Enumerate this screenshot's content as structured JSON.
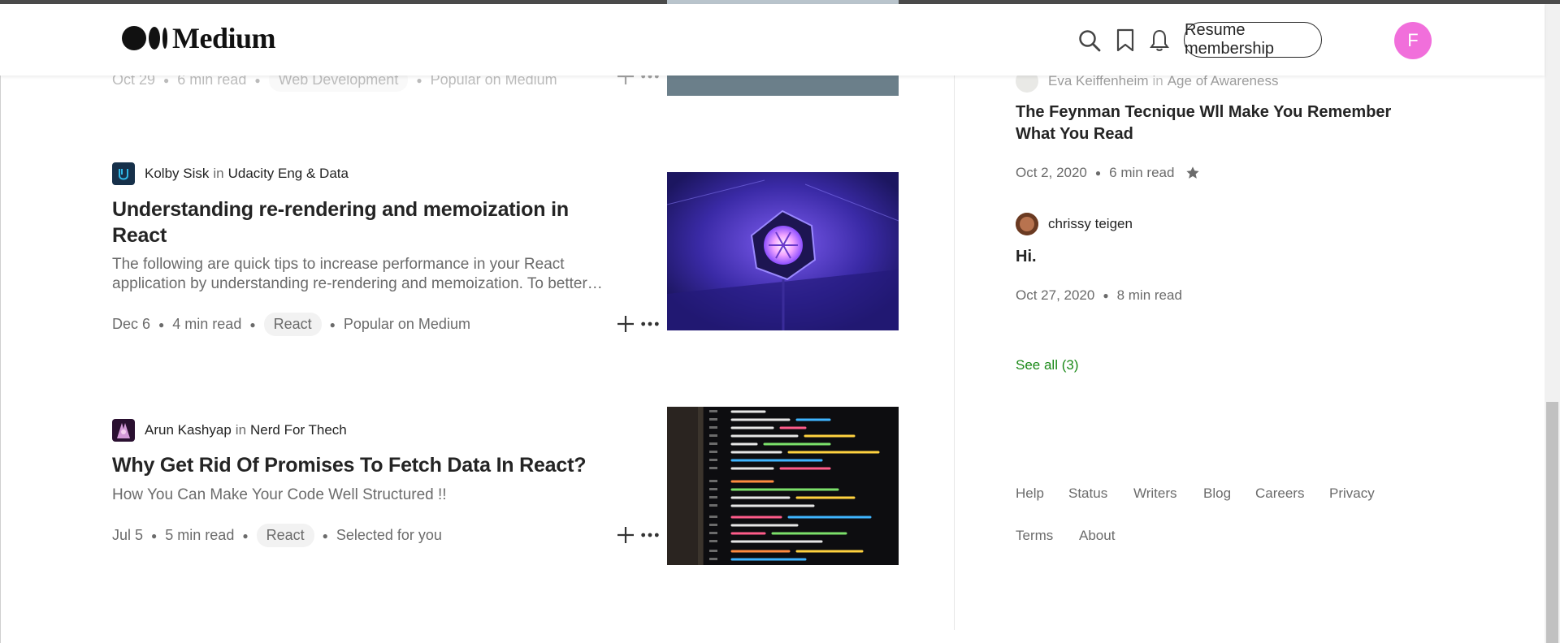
{
  "header": {
    "logo_text": "Medium",
    "icons": [
      "search-icon",
      "bookmark-icon",
      "bell-icon"
    ],
    "resume_label": "Resume membership",
    "avatar_initial": "F",
    "avatar_color": "#f16fdb"
  },
  "articles": [
    {
      "date": "Oct 29",
      "read_time": "6 min read",
      "tag": "Web Development",
      "context": "Popular on Medium"
    },
    {
      "author": "Kolby Sisk",
      "in_label": "in",
      "publication": "Udacity Eng & Data",
      "title": "Understanding re-rendering and memoization in React",
      "subtitle": "The following are quick tips to increase performance in your React application by understanding re-rendering and memoization. To better…",
      "date": "Dec 6",
      "read_time": "4 min read",
      "tag": "React",
      "context": "Popular on Medium"
    },
    {
      "author": "Arun Kashyap",
      "in_label": "in",
      "publication": "Nerd For Thech",
      "title": "Why Get Rid Of Promises To Fetch Data In React?",
      "subtitle": "How You Can Make Your Code Well Structured !!",
      "date": "Jul 5",
      "read_time": "5 min read",
      "tag": "React",
      "context": "Selected for you"
    }
  ],
  "sidebar": {
    "items": [
      {
        "author": "Eva Keiffenheim",
        "in_label": "in",
        "publication": "Age of Awareness",
        "title": "The Feynman Tecnique Wll Make You Remember What You Read",
        "date": "Oct 2, 2020",
        "read_time": "6 min read"
      },
      {
        "author": "chrissy teigen",
        "title": "Hi.",
        "date": "Oct 27, 2020",
        "read_time": "8 min read"
      }
    ],
    "see_all": "See all (3)",
    "see_all_color": "#1a8917",
    "footer_row1": [
      "Help",
      "Status",
      "Writers",
      "Blog",
      "Careers",
      "Privacy"
    ],
    "footer_row2": [
      "Terms",
      "About"
    ]
  }
}
